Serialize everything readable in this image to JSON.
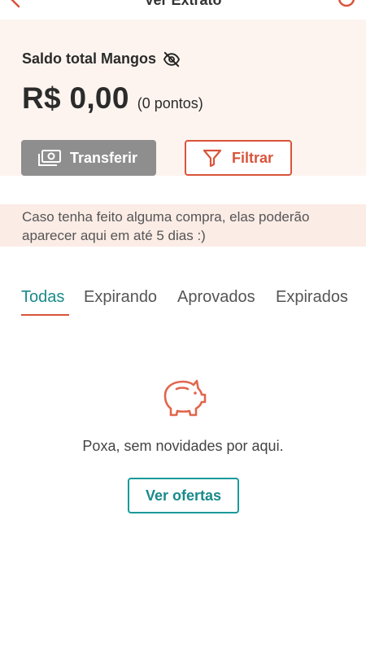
{
  "header": {
    "title": "Ver Extrato"
  },
  "balance": {
    "label": "Saldo total Mangos",
    "value": "R$ 0,00",
    "points": "(0 pontos)"
  },
  "actions": {
    "transfer_label": "Transferir",
    "filter_label": "Filtrar"
  },
  "notice": {
    "text": "Caso tenha feito alguma compra, elas poderão aparecer aqui em até 5 dias :)"
  },
  "tabs": [
    {
      "label": "Todas",
      "active": true
    },
    {
      "label": "Expirando",
      "active": false
    },
    {
      "label": "Aprovados",
      "active": false
    },
    {
      "label": "Expirados",
      "active": false
    }
  ],
  "empty_state": {
    "icon": "piggy-bank-icon",
    "message": "Poxa, sem novidades por aqui.",
    "button_label": "Ver ofertas"
  },
  "colors": {
    "accent": "#d9543b",
    "teal": "#1a8a8a",
    "card_bg": "#fdf4ef",
    "notice_bg": "#fbece6",
    "disabled_button": "#8e8e8e"
  }
}
